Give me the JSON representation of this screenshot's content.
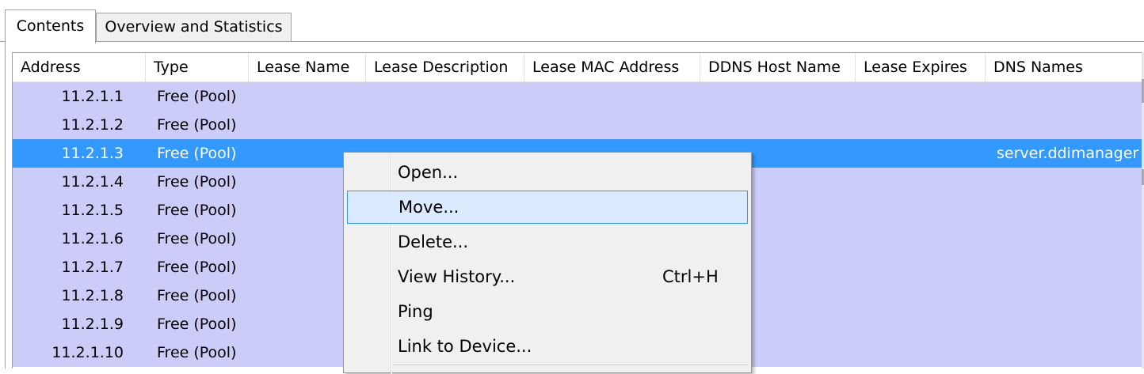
{
  "tabs": [
    {
      "label": "Contents",
      "active": true
    },
    {
      "label": "Overview and Statistics",
      "active": false
    }
  ],
  "columns": [
    "Address",
    "Type",
    "Lease Name",
    "Lease Description",
    "Lease MAC Address",
    "DDNS Host Name",
    "Lease Expires",
    "DNS Names"
  ],
  "rows": [
    {
      "address": "11.2.1.1",
      "type": "Free (Pool)",
      "dns_names": "",
      "selected": false
    },
    {
      "address": "11.2.1.2",
      "type": "Free (Pool)",
      "dns_names": "",
      "selected": false
    },
    {
      "address": "11.2.1.3",
      "type": "Free (Pool)",
      "dns_names": "server.ddimanager",
      "selected": true
    },
    {
      "address": "11.2.1.4",
      "type": "Free (Pool)",
      "dns_names": "",
      "selected": false
    },
    {
      "address": "11.2.1.5",
      "type": "Free (Pool)",
      "dns_names": "",
      "selected": false
    },
    {
      "address": "11.2.1.6",
      "type": "Free (Pool)",
      "dns_names": "",
      "selected": false
    },
    {
      "address": "11.2.1.7",
      "type": "Free (Pool)",
      "dns_names": "",
      "selected": false
    },
    {
      "address": "11.2.1.8",
      "type": "Free (Pool)",
      "dns_names": "",
      "selected": false
    },
    {
      "address": "11.2.1.9",
      "type": "Free (Pool)",
      "dns_names": "",
      "selected": false
    },
    {
      "address": "11.2.1.10",
      "type": "Free (Pool)",
      "dns_names": "",
      "selected": false
    }
  ],
  "context_menu": {
    "items": [
      {
        "label": "Open...",
        "shortcut": "",
        "highlighted": false
      },
      {
        "label": "Move...",
        "shortcut": "",
        "highlighted": true
      },
      {
        "label": "Delete...",
        "shortcut": "",
        "highlighted": false
      },
      {
        "label": "View History...",
        "shortcut": "Ctrl+H",
        "highlighted": false
      },
      {
        "label": "Ping",
        "shortcut": "",
        "highlighted": false
      },
      {
        "label": "Link to Device...",
        "shortcut": "",
        "highlighted": false
      }
    ]
  },
  "colors": {
    "row_background": "#ccccf9",
    "selected_row": "#3399ff",
    "menu_hover": "#dbeaff",
    "menu_hover_border": "#3399dd"
  }
}
